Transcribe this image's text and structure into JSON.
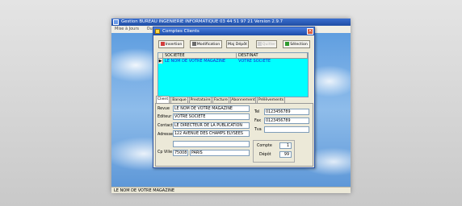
{
  "main_window": {
    "title": "Gestion BUREAU INGENIERIE INFORMATIQUE 03 44 51 97 21 Version 2.9.7",
    "menu": [
      "Mise à Jours",
      "Ou"
    ],
    "status": "LE NOM DE VOTRE MAGAZINE"
  },
  "dialog": {
    "title": "Comptes Clients",
    "close_glyph": "×",
    "toolbar": {
      "insertion": "Insertion",
      "modification": "Modification",
      "maj_depot": "Maj Dépôt",
      "quitter": "Quitter",
      "selection": "Sélection"
    },
    "grid": {
      "columns": [
        "SOCIETEE",
        "DESTINAT"
      ],
      "indicator": "▶",
      "rows": [
        {
          "societee": "LE NOM DE VOTRE MAGAZINE",
          "destinat": "VOTRE SOCIETE"
        }
      ]
    },
    "tabs": [
      "Client",
      "Banque",
      "Prestataire",
      "Facture",
      "Abonnement",
      "Prélèvements"
    ],
    "form": {
      "revue_label": "Revue",
      "revue_value": "LE NOM DE VOTRE MAGAZINE",
      "editeur_label": "Editeur",
      "editeur_value": "VOTRE SOCIETE",
      "contact_label": "Contact",
      "contact_value": "LE DIRECTEUR DE LA PUBLICATION",
      "adresse_label": "Adresse",
      "adresse_value": "122 AVENUE DES CHAMPS ELYSEES",
      "adresse2_value": "",
      "cpville_label": "Cp Ville",
      "cp_value": "75008",
      "ville_value": "PARIS",
      "tel_label": "Tel",
      "tel_value": "0123456789",
      "fax_label": "Fax",
      "fax_value": "0123456789",
      "tva_label": "Tva",
      "tva_value": "",
      "compte_label": "Compte",
      "compte_value": "1",
      "depot_label": "Dépôt",
      "depot_value": "99"
    }
  }
}
